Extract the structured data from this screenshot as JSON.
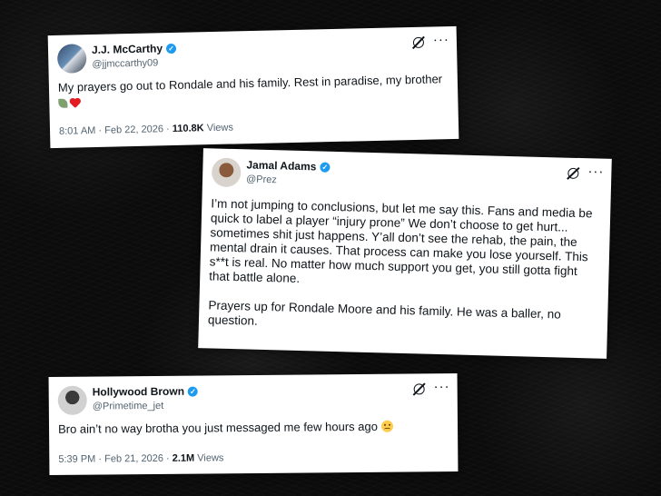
{
  "tweets": [
    {
      "name": "J.J. McCarthy",
      "handle": "@jjmccarthy09",
      "text": "My prayers go out to Rondale and his family. Rest in paradise, my brother",
      "time": "8:01 AM",
      "date": "Feb 22, 2026",
      "view_count": "110.8K",
      "views_label": "Views"
    },
    {
      "name": "Jamal Adams",
      "handle": "@Prez",
      "paragraph_1": "I’m not jumping to conclusions, but let me say this. Fans and media be quick to label a player “injury prone” We don’t choose to get hurt... sometimes shit just happens. Y’all don’t see the rehab, the pain, the mental drain it causes. That process can make you lose yourself. This s**t is real. No matter how much support you get, you still gotta fight that battle alone.",
      "paragraph_2": "Prayers up for Rondale Moore and his family. He was a baller, no question."
    },
    {
      "name": "Hollywood Brown",
      "handle": "@Primetime_jet",
      "text": "Bro ain’t no way brotha you just messaged me few hours ago",
      "time": "5:39 PM",
      "date": "Feb 21, 2026",
      "view_count": "2.1M",
      "views_label": "Views"
    }
  ],
  "separators": {
    "dot": "·"
  },
  "icons": [
    "verified-badge-icon",
    "grok-icon",
    "more-icon",
    "leaf-icon",
    "heart-icon",
    "sad-face-icon"
  ],
  "colors": {
    "background": "#0c0c0c",
    "card": "#ffffff",
    "text": "#0f1419",
    "secondary_text": "#536471",
    "verified": "#1d9bf0",
    "heart": "#e31b23"
  }
}
